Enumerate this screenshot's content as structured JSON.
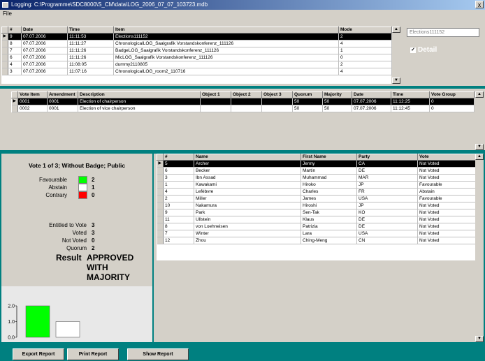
{
  "window": {
    "title": "Logging: C:\\Programme\\SDC8000\\S_CM\\data\\LOG_2006_07_07_103723.mdb",
    "close": "x"
  },
  "menu": {
    "file": "File"
  },
  "log": {
    "headers": [
      "#",
      "Date",
      "Time",
      "Item",
      "Mode"
    ],
    "rows": [
      [
        "9",
        "07.07.2006",
        "11:11:53",
        "Elections111152",
        "2"
      ],
      [
        "8",
        "07.07.2006",
        "11:11:27",
        "ChronologicalLOG_Saalgrafik Vorstandskonferenz_111126",
        "4"
      ],
      [
        "7",
        "07.07.2006",
        "11:11:26",
        "BadgeLOG_Saalgrafik Vorstandskonferenz_111126",
        "1"
      ],
      [
        "6",
        "07.07.2006",
        "11:11:26",
        "MicLOG_Saalgrafik Vorstandskonferenz_111126",
        "0"
      ],
      [
        "4",
        "07.07.2006",
        "11:08:05",
        "dummy2110805",
        "2"
      ],
      [
        "3",
        "07.07.2006",
        "11:07:16",
        "ChronologicalLOG_room2_110716",
        "4"
      ]
    ],
    "selected_item": "Elections111152",
    "detail_label": "Detail",
    "detail_checked": "✓"
  },
  "votes": {
    "headers": [
      "Vote Item",
      "Amendment",
      "Description",
      "Object 1",
      "Object 2",
      "Object 3",
      "Quorum",
      "Majority",
      "Date",
      "Time",
      "Vote Group"
    ],
    "rows": [
      [
        "0001",
        "0001",
        "Election of chairperson",
        "",
        "",
        "",
        "50",
        "50",
        "07.07.2006",
        "11:12:25",
        "0"
      ],
      [
        "0002",
        "0001",
        "Election of vice chairperson",
        "",
        "",
        "",
        "50",
        "50",
        "07.07.2006",
        "11:12:45",
        "0"
      ]
    ]
  },
  "result": {
    "heading": "Vote 1 of 3; Without Badge; Public",
    "favourable_label": "Favourable",
    "favourable": "2",
    "abstain_label": "Abstain",
    "abstain": "1",
    "contrary_label": "Contrary",
    "contrary": "0",
    "entitled_label": "Entitled to Vote",
    "entitled": "3",
    "voted_label": "Voted",
    "voted": "3",
    "not_voted_label": "Not Voted",
    "not_voted": "0",
    "quorum_label": "Quorum",
    "quorum": "2",
    "result_label": "Result",
    "result_line1": "APPROVED",
    "result_line2": "WITH",
    "result_line3": "MAJORITY",
    "colors": {
      "favourable": "#00ff00",
      "abstain": "#ffffff",
      "contrary": "#ff0000"
    }
  },
  "chart_data": {
    "type": "bar",
    "categories": [
      "Favourable",
      "Abstain"
    ],
    "values": [
      2,
      1
    ],
    "colors": [
      "#00ff00",
      "#ffffff"
    ],
    "ylim": [
      0,
      2
    ],
    "yticks": [
      "2.0",
      "1.0",
      "0.0"
    ]
  },
  "delegates": {
    "headers": [
      "#",
      "Name",
      "First Name",
      "Party",
      "Vote"
    ],
    "rows": [
      [
        "5",
        "Archer",
        "Jenny",
        "CA",
        "Not Voted"
      ],
      [
        "6",
        "Becker",
        "Martin",
        "DE",
        "Not Voted"
      ],
      [
        "3",
        "Ibn Assad",
        "Muhammad",
        "MAR",
        "Not Voted"
      ],
      [
        "1",
        "Kawakami",
        "Hiroko",
        "JP",
        "Favourable"
      ],
      [
        "4",
        "Lefèbvre",
        "Charles",
        "FR",
        "Abstain"
      ],
      [
        "2",
        "Miller",
        "James",
        "USA",
        "Favourable"
      ],
      [
        "10",
        "Nakamura",
        "Hiroshi",
        "JP",
        "Not Voted"
      ],
      [
        "9",
        "Park",
        "Sen-Tak",
        "KO",
        "Not Voted"
      ],
      [
        "11",
        "Ullstein",
        "Klaus",
        "DE",
        "Not Voted"
      ],
      [
        "8",
        "von Loehneisen",
        "Patrizia",
        "DE",
        "Not Voted"
      ],
      [
        "7",
        "Winter",
        "Lara",
        "USA",
        "Not Voted"
      ],
      [
        "12",
        "Zhou",
        "Ching-Meng",
        "CN",
        "Not Voted"
      ]
    ]
  },
  "footer": {
    "export": "Export Report",
    "print": "Print Report",
    "show": "Show Report"
  }
}
